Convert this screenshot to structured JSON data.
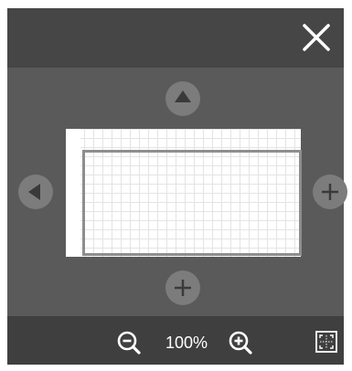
{
  "header": {
    "close_icon": "close-icon"
  },
  "navigation": {
    "up_icon": "triangle-up-icon",
    "left_icon": "triangle-left-icon",
    "right_icon": "plus-icon",
    "down_icon": "plus-icon"
  },
  "footer": {
    "zoom_out_icon": "zoom-out-icon",
    "zoom_level": "100%",
    "zoom_in_icon": "zoom-in-icon",
    "fit_icon": "fit-to-screen-icon"
  },
  "colors": {
    "topbar": "#464646",
    "canvas_area": "#5a5a5a",
    "bottombar": "#3f3f3f",
    "button": "#7c7c7c",
    "icon": "#ffffff"
  }
}
